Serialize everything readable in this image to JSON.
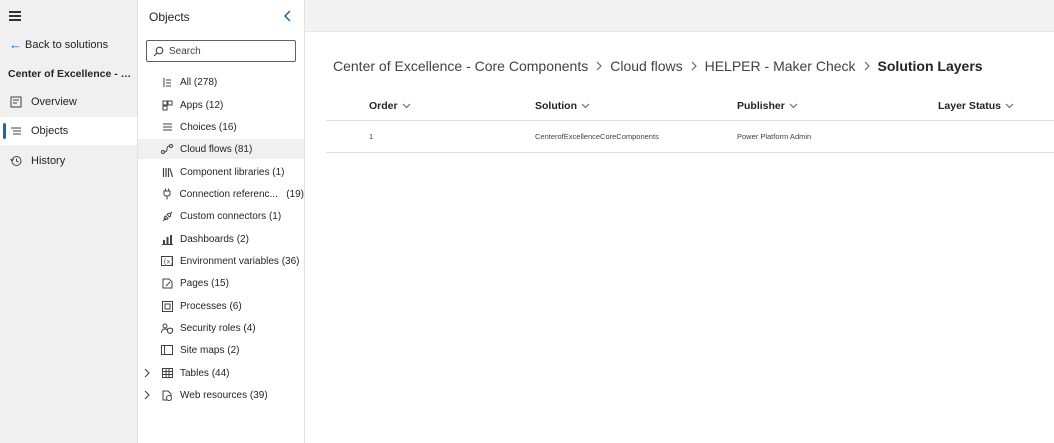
{
  "leftnav": {
    "back_label": "Back to solutions",
    "solution_title": "Center of Excellence - C...",
    "items": [
      {
        "label": "Overview",
        "icon": "overview-icon"
      },
      {
        "label": "Objects",
        "icon": "objects-icon"
      },
      {
        "label": "History",
        "icon": "history-icon"
      }
    ],
    "selected": "Objects"
  },
  "objects_panel": {
    "title": "Objects",
    "search_placeholder": "Search",
    "items": [
      {
        "label": "All",
        "count": "(278)",
        "icon": "all-icon"
      },
      {
        "label": "Apps",
        "count": "(12)",
        "icon": "apps-icon"
      },
      {
        "label": "Choices",
        "count": "(16)",
        "icon": "choices-icon"
      },
      {
        "label": "Cloud flows",
        "count": "(81)",
        "icon": "cloud-flows-icon"
      },
      {
        "label": "Component libraries",
        "count": "(1)",
        "icon": "component-libraries-icon"
      },
      {
        "label": "Connection referenc...",
        "count": "(19)",
        "icon": "connection-references-icon"
      },
      {
        "label": "Custom connectors",
        "count": "(1)",
        "icon": "custom-connectors-icon"
      },
      {
        "label": "Dashboards",
        "count": "(2)",
        "icon": "dashboards-icon"
      },
      {
        "label": "Environment variables",
        "count": "(36)",
        "icon": "environment-variables-icon"
      },
      {
        "label": "Pages",
        "count": "(15)",
        "icon": "pages-icon"
      },
      {
        "label": "Processes",
        "count": "(6)",
        "icon": "processes-icon"
      },
      {
        "label": "Security roles",
        "count": "(4)",
        "icon": "security-roles-icon"
      },
      {
        "label": "Site maps",
        "count": "(2)",
        "icon": "site-maps-icon"
      },
      {
        "label": "Tables",
        "count": "(44)",
        "icon": "tables-icon",
        "expandable": true
      },
      {
        "label": "Web resources",
        "count": "(39)",
        "icon": "web-resources-icon",
        "expandable": true
      }
    ],
    "selected": "Cloud flows"
  },
  "breadcrumb": {
    "items": [
      "Center of Excellence - Core Components",
      "Cloud flows",
      "HELPER - Maker Check"
    ],
    "current": "Solution Layers"
  },
  "grid": {
    "columns": [
      "Order",
      "Solution",
      "Publisher",
      "Layer Status"
    ],
    "rows": [
      {
        "order": "1",
        "solution": "CenterofExcellenceCoreComponents",
        "publisher": "Power Platform Admin",
        "layer_status": ""
      }
    ]
  },
  "colors": {
    "accent": "#0f6cbd",
    "nav_bg": "#f0f0f0",
    "topbar_bg": "#f3f3f3"
  }
}
